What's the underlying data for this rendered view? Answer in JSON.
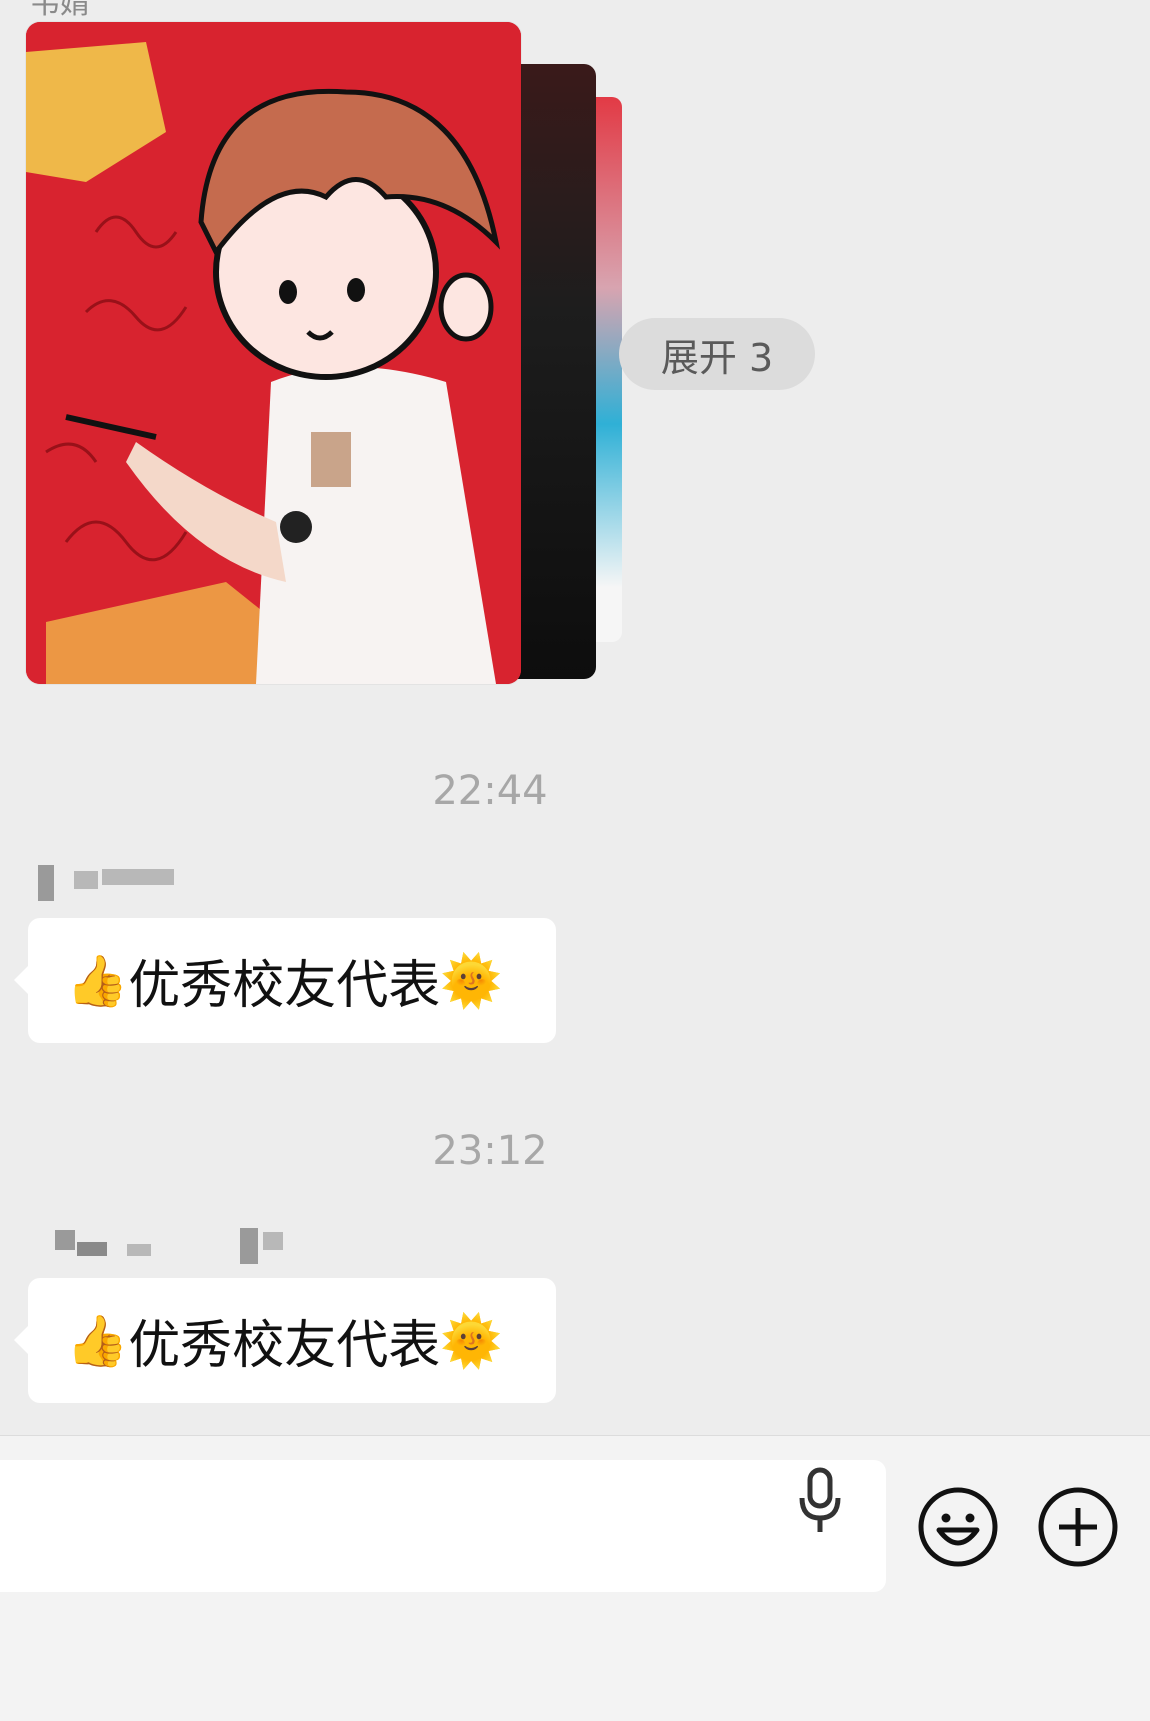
{
  "messages": {
    "sender_top": "韦婧",
    "expand_label": "展开 3",
    "ts1": "22:44",
    "ts2": "23:12",
    "msg1": {
      "thumb": "👍",
      "text": "优秀校友代表",
      "sun": "🌞"
    },
    "msg2": {
      "thumb": "👍",
      "text": "优秀校友代表",
      "sun": "🌞"
    }
  },
  "icons": {
    "mic": "microphone-icon",
    "emoji": "smiley-icon",
    "plus": "plus-icon"
  }
}
